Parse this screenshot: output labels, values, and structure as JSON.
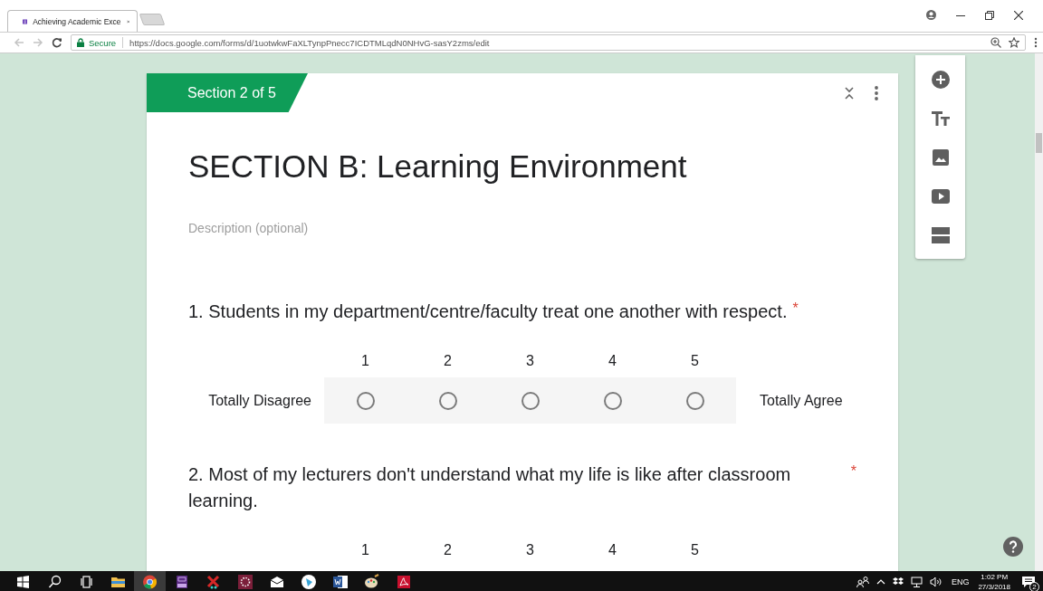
{
  "browser": {
    "tab": {
      "title": "Achieving Academic Exce",
      "selected": true
    },
    "address": {
      "secure_label": "Secure",
      "url": "https://docs.google.com/forms/d/1uotwkwFaXLTynpPnecc7ICDTMLqdN0NHvG-sasY2zms/edit"
    }
  },
  "section": {
    "badge": "Section 2 of 5",
    "title": "SECTION B: Learning Environment",
    "description": {
      "placeholder": "Description (optional)"
    }
  },
  "questions": [
    {
      "text": "1. Students in my department/centre/faculty treat one another with respect.",
      "required_mark": "*",
      "low_label": "Totally Disagree",
      "high_label": "Totally Agree",
      "options": [
        {
          "label": "1",
          "selected": false
        },
        {
          "label": "2",
          "selected": false
        },
        {
          "label": "3",
          "selected": false
        },
        {
          "label": "4",
          "selected": false
        },
        {
          "label": "5",
          "selected": false
        }
      ]
    },
    {
      "text": "2. Most of my lecturers don't understand what my life is like after classroom learning.",
      "required_mark": "*",
      "options": [
        {
          "label": "1"
        },
        {
          "label": "2"
        },
        {
          "label": "3"
        },
        {
          "label": "4"
        },
        {
          "label": "5"
        }
      ]
    }
  ],
  "toolbar": [
    {
      "kind": "add"
    },
    {
      "kind": "title"
    },
    {
      "kind": "image"
    },
    {
      "kind": "video"
    },
    {
      "kind": "section"
    }
  ],
  "taskbar": {
    "apps": [
      {
        "kind": "windows",
        "active": false
      },
      {
        "kind": "search",
        "active": false
      },
      {
        "kind": "taskview",
        "active": false
      },
      {
        "kind": "folder",
        "active": false
      },
      {
        "kind": "browser",
        "active": true
      },
      {
        "kind": "pdfeditor",
        "active": false
      },
      {
        "kind": "tool",
        "active": false
      },
      {
        "kind": "app",
        "active": false
      },
      {
        "kind": "mail",
        "active": false
      },
      {
        "kind": "player",
        "active": false
      },
      {
        "kind": "word",
        "active": false
      },
      {
        "kind": "paint",
        "active": false
      },
      {
        "kind": "pdf",
        "active": false
      }
    ],
    "language": "ENG",
    "time": "1:02 PM",
    "date": "27/3/2018",
    "notifications": "2"
  }
}
